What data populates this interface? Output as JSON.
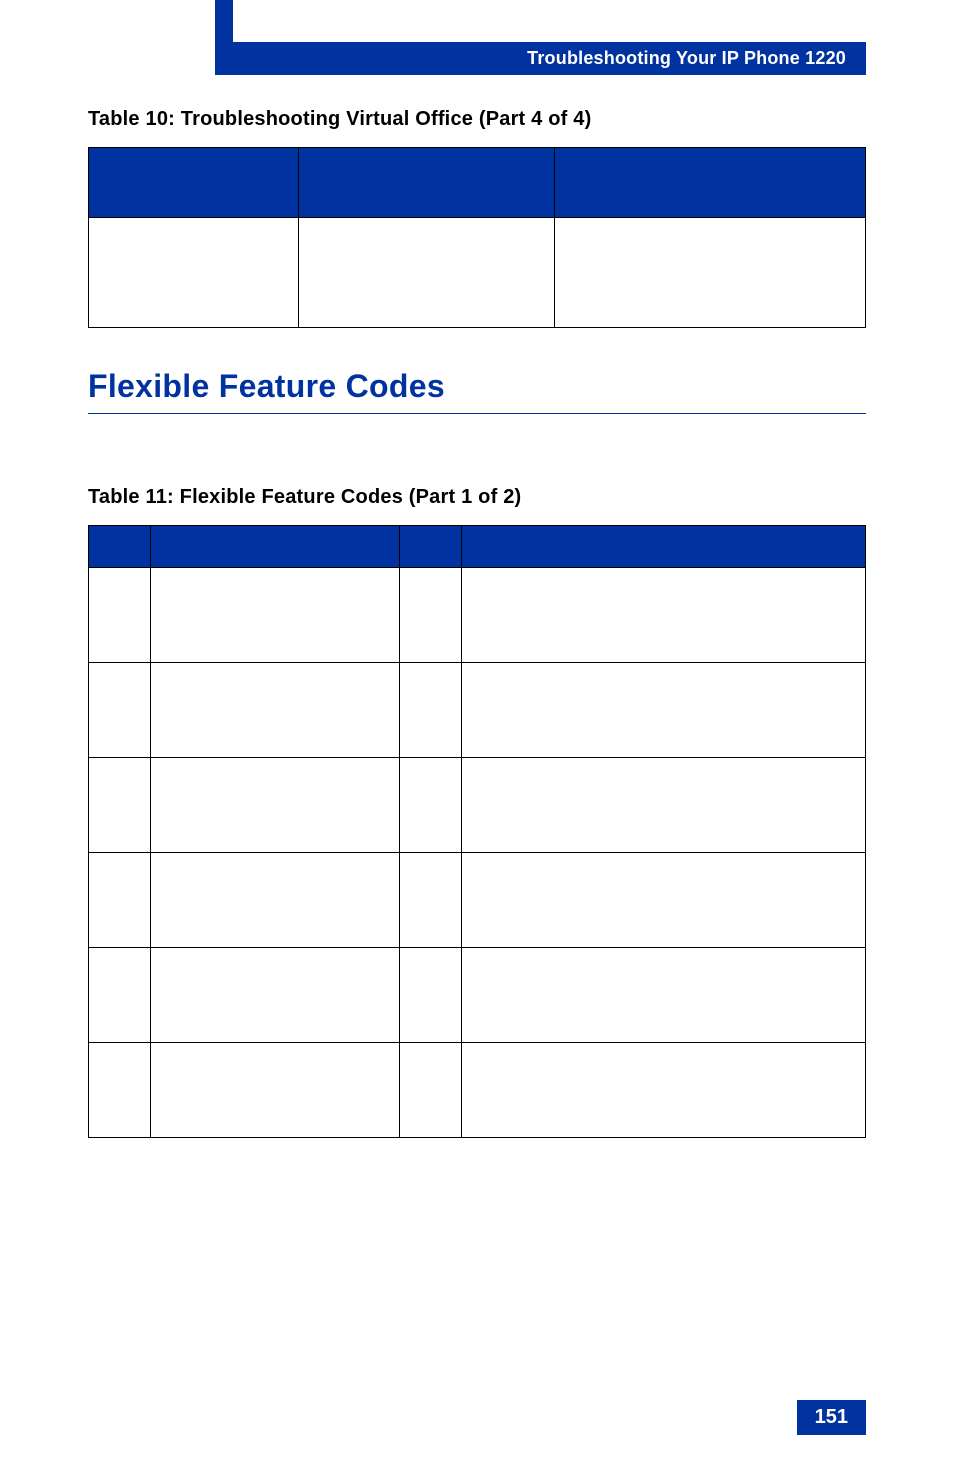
{
  "header": {
    "title": "Troubleshooting Your IP Phone 1220"
  },
  "table10": {
    "caption": "Table 10: Troubleshooting Virtual Office (Part 4 of 4)",
    "headers": [
      "",
      "",
      ""
    ],
    "rows": [
      [
        "",
        "",
        ""
      ]
    ]
  },
  "sectionHeading": "Flexible Feature Codes",
  "table11": {
    "caption": "Table 11: Flexible Feature Codes  (Part 1 of 2)",
    "headers": [
      "",
      "",
      "",
      ""
    ],
    "rows": [
      [
        "",
        "",
        "",
        ""
      ],
      [
        "",
        "",
        "",
        ""
      ],
      [
        "",
        "",
        "",
        ""
      ],
      [
        "",
        "",
        "",
        ""
      ],
      [
        "",
        "",
        "",
        ""
      ],
      [
        "",
        "",
        "",
        ""
      ]
    ]
  },
  "pageNumber": "151"
}
